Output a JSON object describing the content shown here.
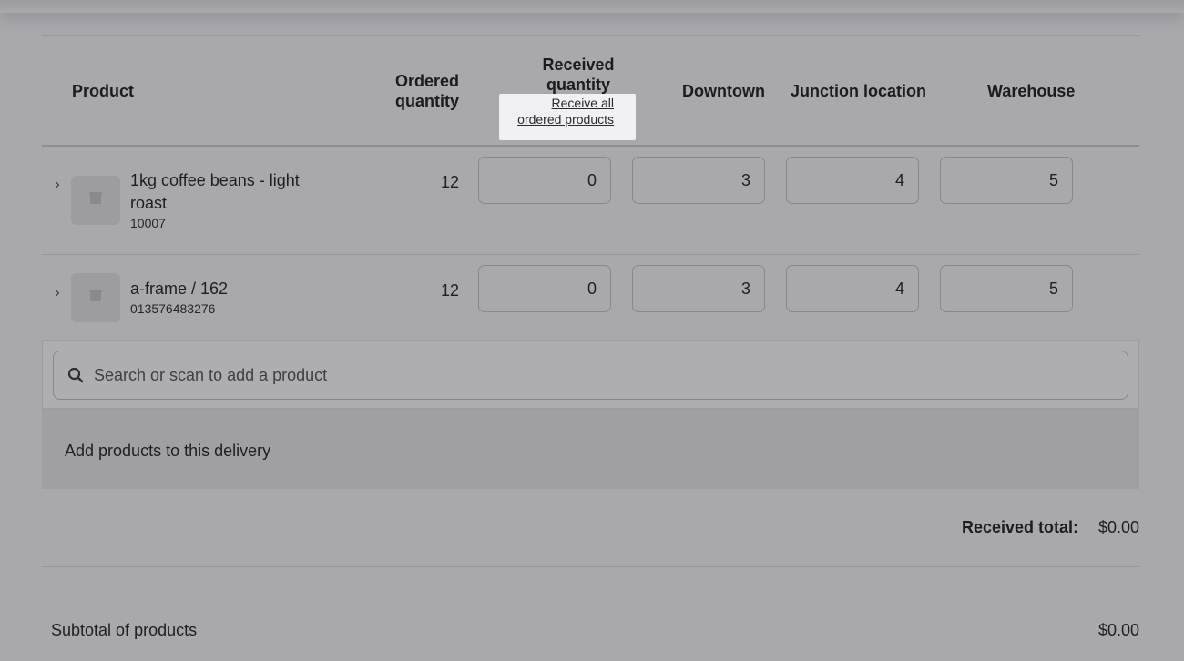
{
  "table": {
    "headers": {
      "product": "Product",
      "ordered_line1": "Ordered",
      "ordered_line2": "quantity",
      "received_line1": "Received",
      "received_line2": "quantity",
      "downtown": "Downtown",
      "junction": "Junction location",
      "warehouse": "Warehouse"
    },
    "receive_all_line1": "Receive all",
    "receive_all_line2": "ordered products",
    "rows": [
      {
        "name_line1": "1kg coffee beans - light",
        "name_line2": "roast",
        "sku": "10007",
        "ordered": "12",
        "received": "0",
        "downtown": "3",
        "junction": "4",
        "warehouse": "5"
      },
      {
        "name_line1": "a-frame / 162",
        "sku": "013576483276",
        "ordered": "12",
        "received": "0",
        "downtown": "3",
        "junction": "4",
        "warehouse": "5"
      }
    ]
  },
  "search": {
    "placeholder": "Search or scan to add a product"
  },
  "add_products_text": "Add products to this delivery",
  "received_total": {
    "label": "Received total:",
    "value": "$0.00"
  },
  "subtotal": {
    "label": "Subtotal of products",
    "value": "$0.00"
  },
  "icons": {
    "expand": "chevron-right-icon",
    "search": "search-icon",
    "placeholder_image": "image-placeholder-icon"
  }
}
